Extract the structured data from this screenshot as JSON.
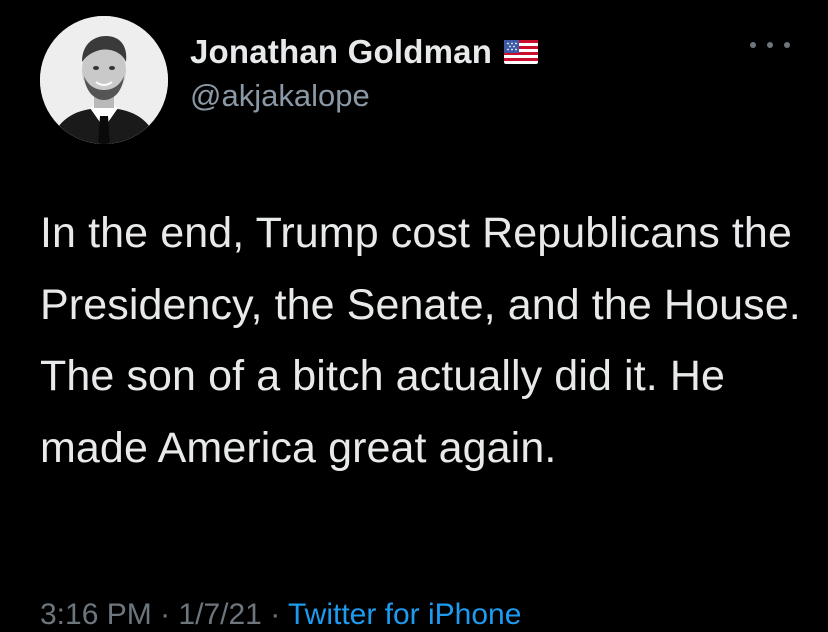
{
  "author": {
    "display_name": "Jonathan Goldman",
    "handle": "@akjakalope",
    "flag_icon": "us-flag-icon"
  },
  "tweet": {
    "text": "In the end, Trump cost Republicans the Presidency, the Senate, and the House. The son of a bitch actually did it. He made America great again.",
    "time": "3:16 PM",
    "date": "1/7/21",
    "separator": "·",
    "source": "Twitter for iPhone"
  },
  "colors": {
    "background": "#000000",
    "text": "#e7e9ea",
    "secondary": "#8b98a5",
    "link": "#1d9bf0"
  }
}
